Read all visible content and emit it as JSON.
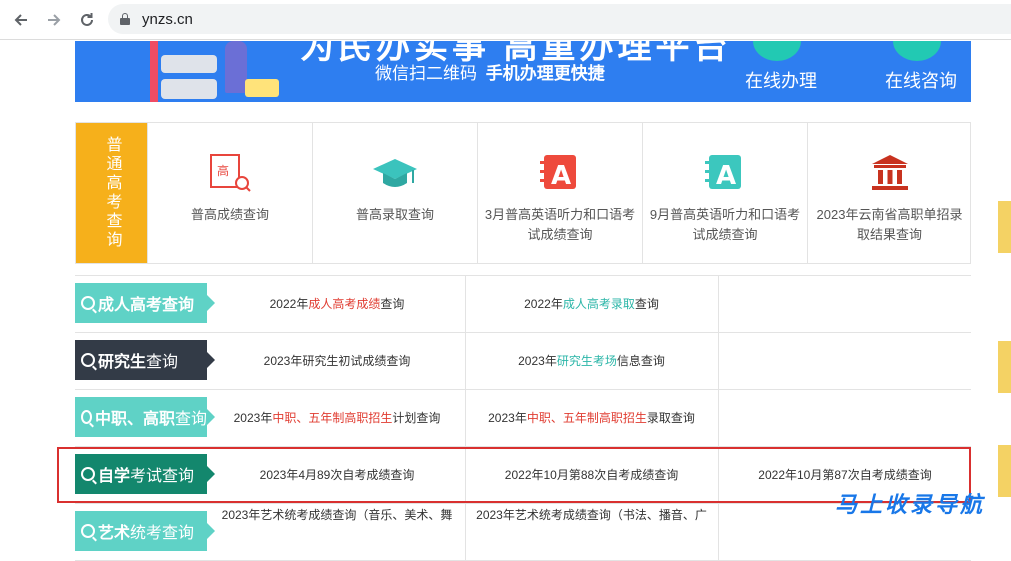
{
  "browser": {
    "url": "ynzs.cn",
    "back_icon": "arrow-left-icon",
    "forward_icon": "arrow-right-icon",
    "reload_icon": "reload-icon"
  },
  "banner": {
    "title": "为民办实事 高重办理平台",
    "subtitle": "微信扫二维码",
    "subtitle_bold": "手机办理更快捷",
    "online_handle": "在线办理",
    "online_consult": "在线咨询"
  },
  "gaokao": {
    "side_label": "普通高考查询",
    "items": [
      {
        "label": "普高成绩查询",
        "icon": "score-search-icon"
      },
      {
        "label": "普高录取查询",
        "icon": "graduation-cap-icon"
      },
      {
        "label": "3月普高英语听力和口语考试成绩查询",
        "icon": "english-a-icon"
      },
      {
        "label": "9月普高英语听力和口语考试成绩查询",
        "icon": "english-a-icon"
      },
      {
        "label": "2023年云南省高职单招录取结果查询",
        "icon": "institution-icon"
      }
    ]
  },
  "query_rows": [
    {
      "tag_bold": "成人高考查询",
      "tag_rest": "",
      "c1": {
        "pre": "2022年",
        "hl": "成人高考成绩",
        "post": "查询"
      },
      "c2": {
        "pre": "2022年",
        "hl": "成人高考录取",
        "post": "查询"
      },
      "c3": ""
    },
    {
      "tag_bold": "研究生",
      "tag_rest": "查询",
      "c1": {
        "pre": "2023年研究生初试成绩查询",
        "hl": "",
        "post": ""
      },
      "c2": {
        "pre": "2023年",
        "hl": "研究生考场",
        "post": "信息查询"
      },
      "c3": ""
    },
    {
      "tag_bold": "中职、高职",
      "tag_rest": "查询",
      "c1": {
        "pre": "2023年",
        "hl": "中职、五年制高职招生",
        "post": "计划查询"
      },
      "c2": {
        "pre": "2023年",
        "hl": "中职、五年制高职招生",
        "post": "录取查询"
      },
      "c3": ""
    },
    {
      "tag_bold": "自学",
      "tag_rest": "考试查询",
      "c1": {
        "pre": "2023年4月89次自考成绩查询",
        "hl": "",
        "post": ""
      },
      "c2": {
        "pre": "2022年10月第88次自考成绩查询",
        "hl": "",
        "post": ""
      },
      "c3": {
        "pre": "2022年10月第87次自考成绩查询",
        "hl": "",
        "post": ""
      }
    },
    {
      "tag_bold": "艺术",
      "tag_rest": "统考查询",
      "c1": {
        "pre": "2023年艺术统考成绩查询（音乐、美术、舞",
        "hl": "",
        "post": ""
      },
      "c2": {
        "pre": "2023年艺术统考成绩查询（书法、播音、广",
        "hl": "",
        "post": ""
      },
      "c3": ""
    }
  ],
  "watermark": "马上收录导航",
  "colors": {
    "banner_blue": "#2e7ef0",
    "gaokao_side": "#f6b01b",
    "tag_teal": "#5fd2c6",
    "tag_dark": "#333b47",
    "tag_green": "#13876d",
    "highlight_red": "#e03c31",
    "highlight_teal": "#2bb6a8",
    "outline_red": "#d9302f"
  }
}
